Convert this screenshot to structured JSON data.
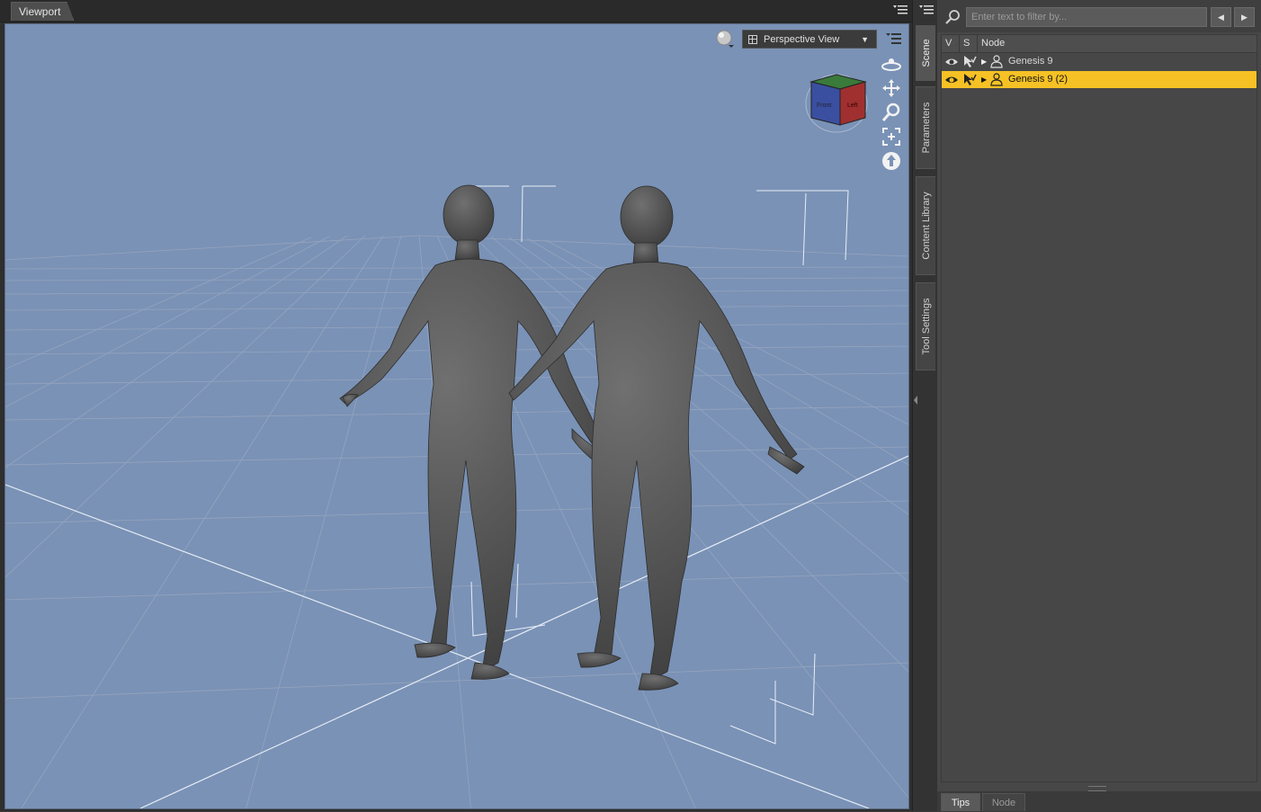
{
  "viewport": {
    "tab_label": "Viewport",
    "view_select": "Perspective View",
    "cube_faces": {
      "front": "Front",
      "left": "Left"
    }
  },
  "nav_tools": [
    {
      "name": "orbit-icon"
    },
    {
      "name": "pan-icon"
    },
    {
      "name": "zoom-icon"
    },
    {
      "name": "frame-icon"
    },
    {
      "name": "reset-view-icon"
    }
  ],
  "side_tabs": [
    "Scene",
    "Parameters",
    "Content Library",
    "Tool Settings"
  ],
  "scene": {
    "filter_placeholder": "Enter text to filter by...",
    "columns": {
      "v": "V",
      "s": "S",
      "node": "Node"
    },
    "rows": [
      {
        "name": "Genesis 9",
        "selected": false
      },
      {
        "name": "Genesis 9 (2)",
        "selected": true
      }
    ]
  },
  "bottom_tabs": [
    "Tips",
    "Node"
  ],
  "colors": {
    "viewport_bg": "#7a92b6",
    "selection": "#f5c125",
    "figure": "#5a5a5a"
  }
}
